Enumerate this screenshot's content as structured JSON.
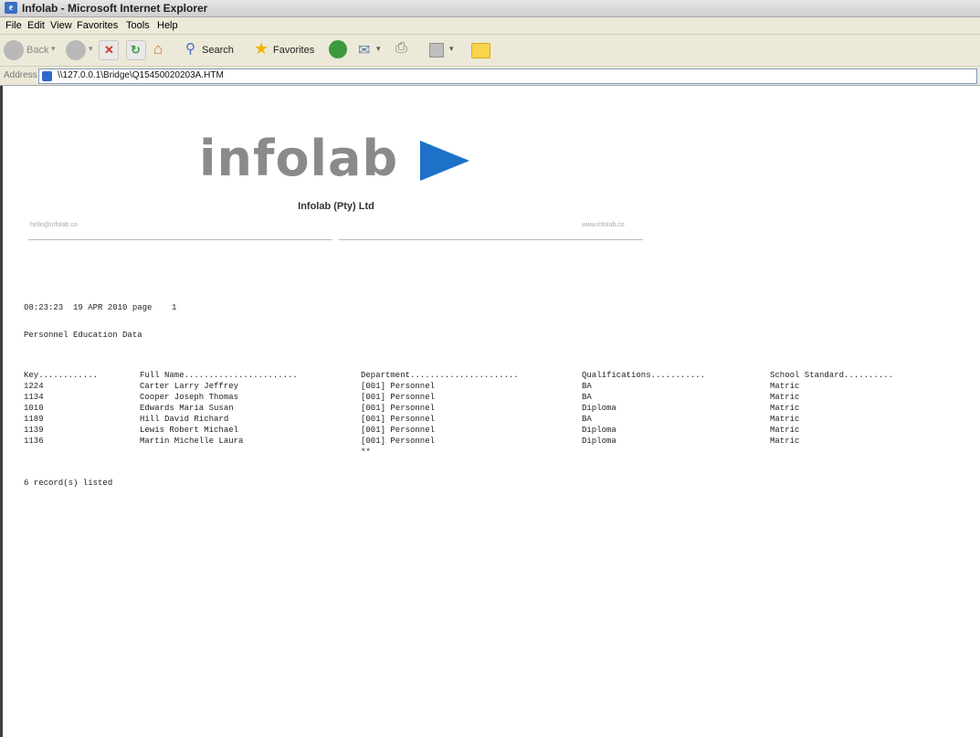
{
  "window": {
    "title": "Infolab - Microsoft Internet Explorer"
  },
  "menu": [
    "File",
    "Edit",
    "View",
    "Favorites",
    "Tools",
    "Help"
  ],
  "toolbar": {
    "back_label": "Back",
    "search_label": "Search",
    "favorites_label": "Favorites"
  },
  "address": {
    "label": "Address",
    "value": "\\\\127.0.0.1\\Bridge\\Q15450020203A.HTM"
  },
  "page": {
    "logo_text": "infolab",
    "company": "Infolab (Pty) Ltd",
    "contact_left": "hello@infolab.co",
    "contact_right": "www.infolab.co",
    "timestamp": "08:23:23  19 APR 2010 page    1",
    "report_title": "Personnel Education Data",
    "columns": [
      "Key............",
      "Full Name.......................",
      "Department......................",
      "Qualifications...........",
      "School Standard.........."
    ],
    "rows": [
      [
        "1224",
        "Carter Larry Jeffrey",
        "[001] Personnel",
        "BA",
        "Matric"
      ],
      [
        "1134",
        "Cooper Joseph Thomas",
        "[001] Personnel",
        "BA",
        "Matric"
      ],
      [
        "1010",
        "Edwards Maria Susan",
        "[001] Personnel",
        "Diploma",
        "Matric"
      ],
      [
        "1189",
        "Hill David Richard",
        "[001] Personnel",
        "BA",
        "Matric"
      ],
      [
        "1139",
        "Lewis Robert Michael",
        "[001] Personnel",
        "Diploma",
        "Matric"
      ],
      [
        "1136",
        "Martin Michelle Laura",
        "[001] Personnel",
        "Diploma",
        "Matric"
      ]
    ],
    "department_footer": "**",
    "record_count": "6 record(s) listed"
  },
  "colors": {
    "logo_gray": "#8a8a8a",
    "logo_blue": "#1e71c8",
    "chrome": "#ece9d8"
  }
}
